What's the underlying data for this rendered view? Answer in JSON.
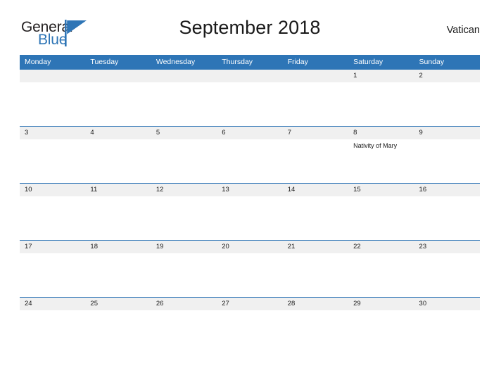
{
  "brand": {
    "name_part1": "General",
    "name_part2": "Blue",
    "flag_icon": "blue-triangle-flag-icon"
  },
  "header": {
    "title": "September 2018",
    "region": "Vatican"
  },
  "colors": {
    "header_blue": "#2e75b6",
    "date_band_gray": "#f0f0f0",
    "text_dark": "#1a1a1a",
    "brand_blue": "#2e75b6"
  },
  "calendar": {
    "weekday_headers": [
      "Monday",
      "Tuesday",
      "Wednesday",
      "Thursday",
      "Friday",
      "Saturday",
      "Sunday"
    ],
    "weeks": [
      {
        "ruled": false,
        "days": [
          {
            "date": "",
            "events": []
          },
          {
            "date": "",
            "events": []
          },
          {
            "date": "",
            "events": []
          },
          {
            "date": "",
            "events": []
          },
          {
            "date": "",
            "events": []
          },
          {
            "date": "1",
            "events": []
          },
          {
            "date": "2",
            "events": []
          }
        ]
      },
      {
        "ruled": true,
        "days": [
          {
            "date": "3",
            "events": []
          },
          {
            "date": "4",
            "events": []
          },
          {
            "date": "5",
            "events": []
          },
          {
            "date": "6",
            "events": []
          },
          {
            "date": "7",
            "events": []
          },
          {
            "date": "8",
            "events": [
              "Nativity of Mary"
            ]
          },
          {
            "date": "9",
            "events": []
          }
        ]
      },
      {
        "ruled": true,
        "days": [
          {
            "date": "10",
            "events": []
          },
          {
            "date": "11",
            "events": []
          },
          {
            "date": "12",
            "events": []
          },
          {
            "date": "13",
            "events": []
          },
          {
            "date": "14",
            "events": []
          },
          {
            "date": "15",
            "events": []
          },
          {
            "date": "16",
            "events": []
          }
        ]
      },
      {
        "ruled": true,
        "days": [
          {
            "date": "17",
            "events": []
          },
          {
            "date": "18",
            "events": []
          },
          {
            "date": "19",
            "events": []
          },
          {
            "date": "20",
            "events": []
          },
          {
            "date": "21",
            "events": []
          },
          {
            "date": "22",
            "events": []
          },
          {
            "date": "23",
            "events": []
          }
        ]
      },
      {
        "ruled": true,
        "days": [
          {
            "date": "24",
            "events": []
          },
          {
            "date": "25",
            "events": []
          },
          {
            "date": "26",
            "events": []
          },
          {
            "date": "27",
            "events": []
          },
          {
            "date": "28",
            "events": []
          },
          {
            "date": "29",
            "events": []
          },
          {
            "date": "30",
            "events": []
          }
        ]
      }
    ]
  }
}
